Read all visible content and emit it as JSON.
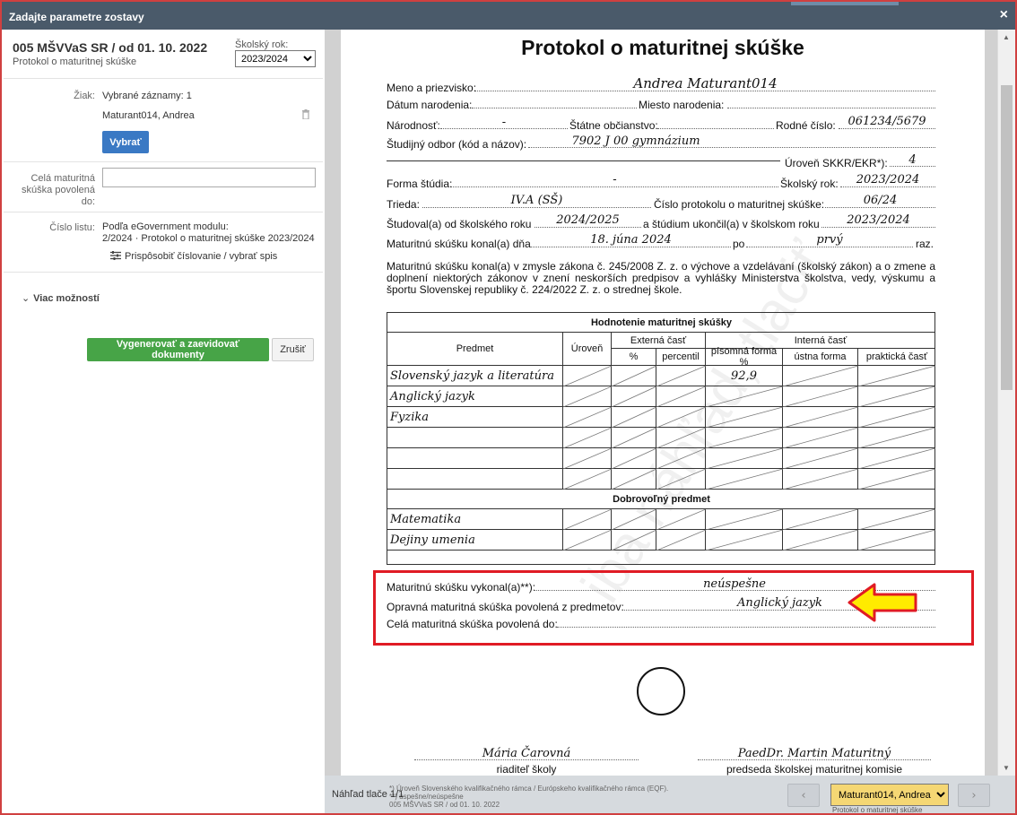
{
  "dialog": {
    "title": "Zadajte parametre zostavy",
    "close": "×"
  },
  "left": {
    "report_title": "005 MŠVVaS SR / od 01. 10. 2022",
    "report_subtitle": "Protokol o maturitnej skúške",
    "year_label": "Školský rok:",
    "year_value": "2023/2024",
    "student_label": "Žiak:",
    "selected": "Vybrané záznamy: 1",
    "student_name": "Maturant014, Andrea",
    "select_button": "Vybrať",
    "allowed_label_1": "Celá maturitná",
    "allowed_label_2": "skúška povolená",
    "allowed_label_3": "do:",
    "sheet_label": "Číslo listu:",
    "sheet_value_1": "Podľa eGovernment modulu:",
    "sheet_value_2": "2/2024 · Protokol o maturitnej skúške 2023/2024",
    "customize_link": "Prispôsobiť číslovanie / vybrať spis",
    "more_options": "Viac možností",
    "generate_button": "Vygenerovať a zaevidovať dokumenty",
    "cancel_button": "Zrušiť"
  },
  "doc": {
    "title": "Protokol o maturitnej skúške",
    "watermark": "iba náhľad, tlačiť",
    "f_name": "Meno a priezvisko:",
    "v_name": "Andrea Maturant014",
    "f_birthdate": "Dátum narodenia:",
    "f_birthplace": "Miesto narodenia:",
    "f_nationality": "Národnosť:",
    "v_nationality": "-",
    "f_citizenship": "Štátne občianstvo:",
    "f_birthnum": "Rodné číslo:",
    "v_birthnum": "061234/5679",
    "f_field": "Študijný odbor (kód a názov):",
    "v_field": "7902 J 00 gymnázium",
    "f_level": "Úroveň SKKR/EKR*):",
    "v_level": "4",
    "f_form": "Forma štúdia:",
    "v_form": "-",
    "f_year": "Školský rok:",
    "v_year": "2023/2024",
    "f_class": "Trieda:",
    "v_class": "IV.A (SŠ)",
    "f_protocol": "Číslo protokolu o maturitnej skúške:",
    "v_protocol": "06/24",
    "f_studied": "Študoval(a) od školského roku",
    "v_studied_from": "2024/2025",
    "f_finished": "a štúdium ukončil(a) v školskom roku",
    "v_finished": "2023/2024",
    "f_exam_date": "Maturitnú skúšku konal(a) dňa",
    "v_exam_date": "18. júna 2024",
    "f_po": "po",
    "v_attempt": "prvý",
    "f_raz": "raz.",
    "paragraph": "Maturitnú skúšku konal(a) v zmysle zákona č. 245/2008 Z. z. o výchove a vzdelávaní (školský zákon) a o zmene a doplnení niektorých zákonov v znení neskorších predpisov a vyhlášky Ministerstva školstva, vedy, výskumu a športu Slovenskej republiky č. 224/2022 Z. z. o strednej škole.",
    "table": {
      "title": "Hodnotenie maturitnej skúšky",
      "h_subject": "Predmet",
      "h_level": "Úroveň",
      "h_external": "Externá časť",
      "h_internal": "Interná časť",
      "h_pct": "%",
      "h_percentile": "percentil",
      "h_written": "písomná forma %",
      "h_oral": "ústna forma",
      "h_practical": "praktická časť",
      "subjects": [
        "Slovenský jazyk a literatúra",
        "Anglický jazyk",
        "Fyzika",
        "",
        "",
        ""
      ],
      "written_values": [
        "92,9",
        "",
        "",
        "",
        "",
        ""
      ],
      "voluntary_title": "Dobrovoľný predmet",
      "voluntary": [
        "Matematika",
        "Dejiny umenia"
      ]
    },
    "f_result": "Maturitnú skúšku vykonal(a)**):",
    "v_result": "neúspešne",
    "f_retake": "Opravná maturitná skúška povolená z predmetov:",
    "v_retake": "Anglický jazyk",
    "f_full": "Celá maturitná skúška povolená do:",
    "sig1_name": "Mária Čarovná",
    "sig1_role": "riaditeľ školy",
    "sig2_name": "PaedDr. Martin Maturitný",
    "sig2_role": "predseda školskej maturitnej komisie"
  },
  "bottom": {
    "preview_label": "Náhľad tlače 1/1",
    "foot_1": "*) Úroveň Slovenského kvalifikačného rámca / Európskeho kvalifikačného rámca (EQF).",
    "foot_2": "**) úspešne/neúspešne",
    "foot_3": "005 MŠVVaS SR / od 01. 10. 2022",
    "prev": "‹",
    "next": "›",
    "student_select": "Maturant014, Andrea",
    "under_text": "Protokol o maturitnej skúške"
  },
  "colors": {
    "highlight_box": "#e01b24",
    "arrow_fill": "#ffeb00",
    "arrow_stroke": "#e01b24",
    "generate": "#47a447",
    "select": "#3a79c4"
  }
}
